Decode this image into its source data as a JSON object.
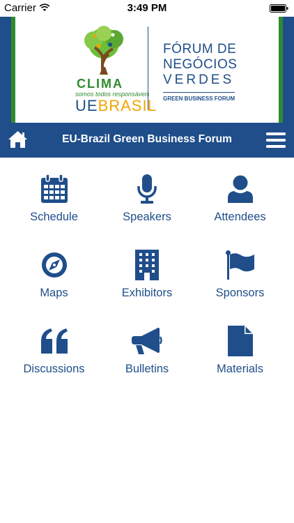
{
  "status_bar": {
    "carrier": "Carrier",
    "time": "3:49 PM"
  },
  "banner": {
    "clima": "CLIMA",
    "clima_tagline": "somos todos responsáveis",
    "ue": "UE",
    "brasil": "BRASIL",
    "forum_line1": "FÓRUM DE",
    "forum_line2": "NEGÓCIOS",
    "forum_line3": "VERDES",
    "forum_english": "GREEN BUSINESS FORUM"
  },
  "navbar": {
    "title": "EU-Brazil Green Business Forum",
    "home_icon": "home-icon",
    "menu_icon": "hamburger-menu-icon"
  },
  "tiles": [
    {
      "label": "Schedule",
      "icon": "calendar-icon"
    },
    {
      "label": "Speakers",
      "icon": "microphone-icon"
    },
    {
      "label": "Attendees",
      "icon": "user-icon"
    },
    {
      "label": "Maps",
      "icon": "compass-icon"
    },
    {
      "label": "Exhibitors",
      "icon": "building-icon"
    },
    {
      "label": "Sponsors",
      "icon": "flag-icon"
    },
    {
      "label": "Discussions",
      "icon": "quote-icon"
    },
    {
      "label": "Bulletins",
      "icon": "megaphone-icon"
    },
    {
      "label": "Materials",
      "icon": "document-icon"
    }
  ],
  "colors": {
    "primary": "#1f4e8a",
    "green": "#2e8b2e",
    "gold": "#f0a500"
  }
}
